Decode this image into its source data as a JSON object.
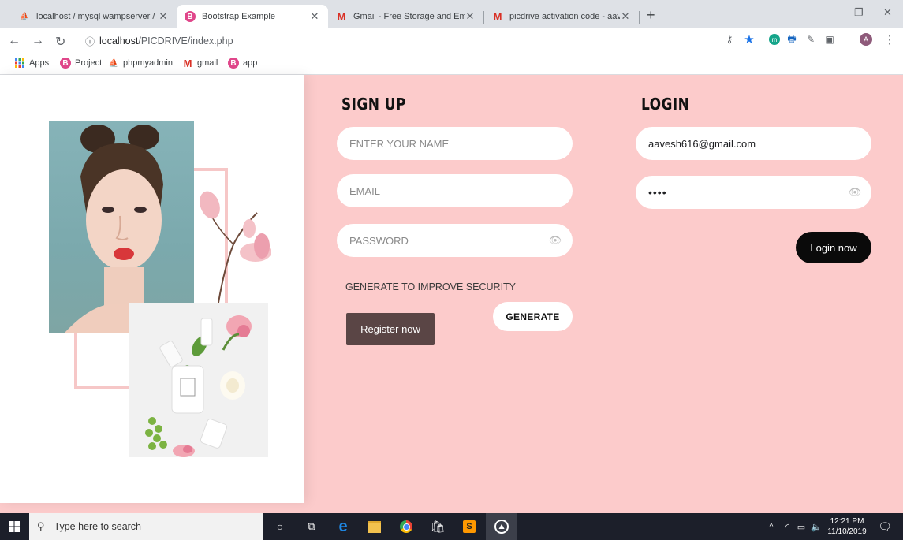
{
  "browser": {
    "tabs": [
      {
        "title": "localhost / mysql wampserver / p",
        "active": false
      },
      {
        "title": "Bootstrap Example",
        "active": true
      },
      {
        "title": "Gmail - Free Storage and Email fr",
        "active": false
      },
      {
        "title": "picdrive activation code - aavesh",
        "active": false
      }
    ],
    "new_tab_symbol": "+",
    "url_host": "localhost",
    "url_path": "/PICDRIVE/index.php",
    "profile_letter": "A",
    "bookmarks": [
      {
        "label": "Apps",
        "icon": "apps-grid-icon"
      },
      {
        "label": "Project",
        "icon": "bootstrap-icon"
      },
      {
        "label": "phpmyadmin",
        "icon": "phpmyadmin-icon"
      },
      {
        "label": "gmail",
        "icon": "gmail-icon"
      },
      {
        "label": "app",
        "icon": "bootstrap-icon"
      }
    ]
  },
  "signup": {
    "title": "SIGN UP",
    "name_placeholder": "ENTER YOUR NAME",
    "email_placeholder": "EMAIL",
    "password_placeholder": "PASSWORD",
    "generate_hint": "GENERATE TO IMPROVE SECURITY",
    "generate_label": "GENERATE",
    "register_label": "Register now"
  },
  "login": {
    "title": "LOGIN",
    "email_value": "aavesh616@gmail.com",
    "password_value": "••••",
    "login_label": "Login now"
  },
  "taskbar": {
    "search_placeholder": "Type here to search",
    "time": "12:21 PM",
    "date": "11/10/2019"
  },
  "colors": {
    "page_bg": "#fccbcb",
    "register_btn": "#5a4545",
    "login_btn": "#0a0a0a",
    "taskbar": "#1c1f2a"
  }
}
